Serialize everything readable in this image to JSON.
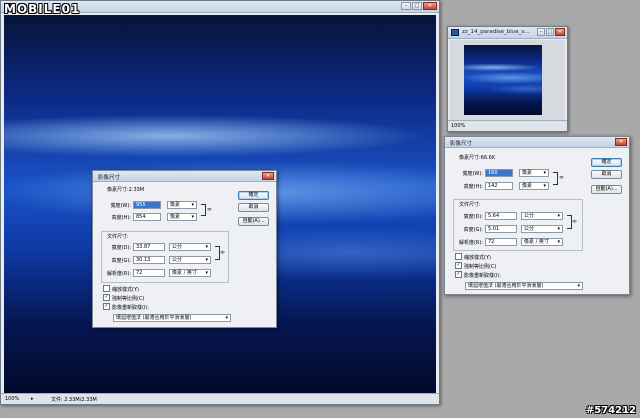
{
  "watermark_brand": "MOBILE01",
  "watermark_id": "#574212",
  "main_window": {
    "title": "",
    "status": {
      "zoom": "100%",
      "doc_info": "文件: 2.33M/2.33M"
    }
  },
  "small_window": {
    "title": "zz_14_paradise_blue_s...",
    "status": {
      "zoom": "100%"
    }
  },
  "dialog_left": {
    "title": "影像尺寸",
    "pixel_group_label": "像素尺寸:2.33M",
    "width_label": "寬度(W):",
    "width_value": "955",
    "width_unit": "像素",
    "height_label": "高度(H):",
    "height_value": "854",
    "height_unit": "像素",
    "doc_group_label": "文件尺寸:",
    "doc_width_label": "寬度(D):",
    "doc_width_value": "33.87",
    "doc_width_unit": "公分",
    "doc_height_label": "高度(G):",
    "doc_height_value": "30.13",
    "doc_height_unit": "公分",
    "resolution_label": "解析度(R):",
    "resolution_value": "72",
    "resolution_unit": "像素 / 英寸",
    "scale_styles": "縮放樣式(Y)",
    "constrain": "強制等比例(C)",
    "resample": "影像重新取樣(I):",
    "resample_method": "環迴增值法 (最適合用於平滑漸層)",
    "ok": "確定",
    "cancel": "取消",
    "auto": "自動(A)..."
  },
  "dialog_right": {
    "title": "影像尺寸",
    "pixel_group_label": "像素尺寸:66.6K",
    "width_label": "寬度(W):",
    "width_value": "160",
    "width_unit": "像素",
    "height_label": "高度(H):",
    "height_value": "142",
    "height_unit": "像素",
    "doc_group_label": "文件尺寸:",
    "doc_width_label": "寬度(D):",
    "doc_width_value": "5.64",
    "doc_width_unit": "公分",
    "doc_height_label": "高度(G):",
    "doc_height_value": "5.01",
    "doc_height_unit": "公分",
    "resolution_label": "解析度(R):",
    "resolution_value": "72",
    "resolution_unit": "像素 / 英寸",
    "scale_styles": "縮放樣式(Y)",
    "constrain": "強制等比例(C)",
    "resample": "影像重新取樣(I):",
    "resample_method": "環迴增值法 (最適合用於平滑漸層)",
    "ok": "確定",
    "cancel": "取消",
    "auto": "自動(A)..."
  },
  "icons": {
    "checked": "✓",
    "dropdown": "▾",
    "minimize": "–",
    "maximize": "□",
    "close": "✕",
    "link": "🔗"
  }
}
